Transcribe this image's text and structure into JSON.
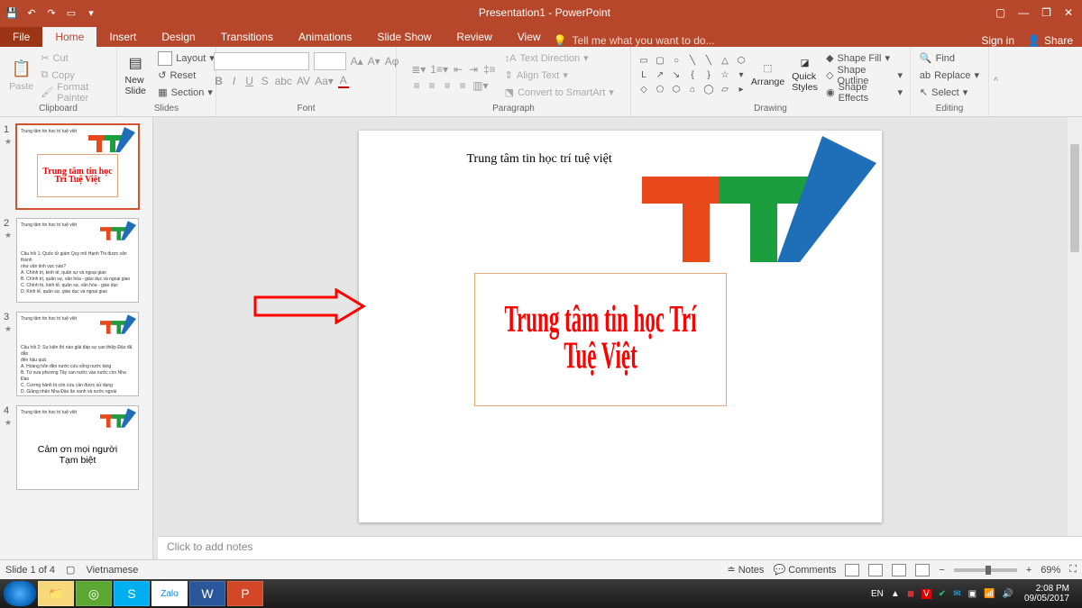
{
  "titlebar": {
    "title": "Presentation1 - PowerPoint"
  },
  "tabs": {
    "file": "File",
    "home": "Home",
    "insert": "Insert",
    "design": "Design",
    "transitions": "Transitions",
    "animations": "Animations",
    "slideshow": "Slide Show",
    "review": "Review",
    "view": "View",
    "tell": "Tell me what you want to do...",
    "signin": "Sign in",
    "share": "Share"
  },
  "ribbon": {
    "clipboard": {
      "paste": "Paste",
      "cut": "Cut",
      "copy": "Copy",
      "format_painter": "Format Painter",
      "label": "Clipboard"
    },
    "slides": {
      "new_slide": "New\nSlide",
      "layout": "Layout",
      "reset": "Reset",
      "section": "Section",
      "label": "Slides"
    },
    "font": {
      "label": "Font"
    },
    "paragraph": {
      "text_direction": "Text Direction",
      "align_text": "Align Text",
      "smartart": "Convert to SmartArt",
      "label": "Paragraph"
    },
    "drawing": {
      "arrange": "Arrange",
      "quick_styles": "Quick\nStyles",
      "shape_fill": "Shape Fill",
      "shape_outline": "Shape Outline",
      "shape_effects": "Shape Effects",
      "label": "Drawing"
    },
    "editing": {
      "find": "Find",
      "replace": "Replace",
      "select": "Select",
      "label": "Editing"
    }
  },
  "thumbs": {
    "1": {
      "title": "Trung tâm tin học trí tuệ việt",
      "wordart": "Trung tâm tin học Trí Tuệ Việt"
    },
    "2": {
      "title": "Trung tâm tin học trí tuệ việt"
    },
    "3": {
      "title": "Trung tâm tin học trí tuệ việt"
    },
    "4": {
      "title": "Trung tâm tin học trí tuệ việt",
      "line1": "Cảm ơn mọi người",
      "line2": "Tạm biệt"
    }
  },
  "slide": {
    "title": "Trung tâm tin học trí tuệ việt",
    "wordart": "Trung tâm tin học Trí Tuệ Việt"
  },
  "notes": {
    "placeholder": "Click to add notes"
  },
  "status": {
    "slide": "Slide 1 of 4",
    "lang": "Vietnamese",
    "notes": "Notes",
    "comments": "Comments",
    "zoom": "69%"
  },
  "tray": {
    "lang": "EN",
    "time": "2:08 PM",
    "date": "09/05/2017"
  }
}
